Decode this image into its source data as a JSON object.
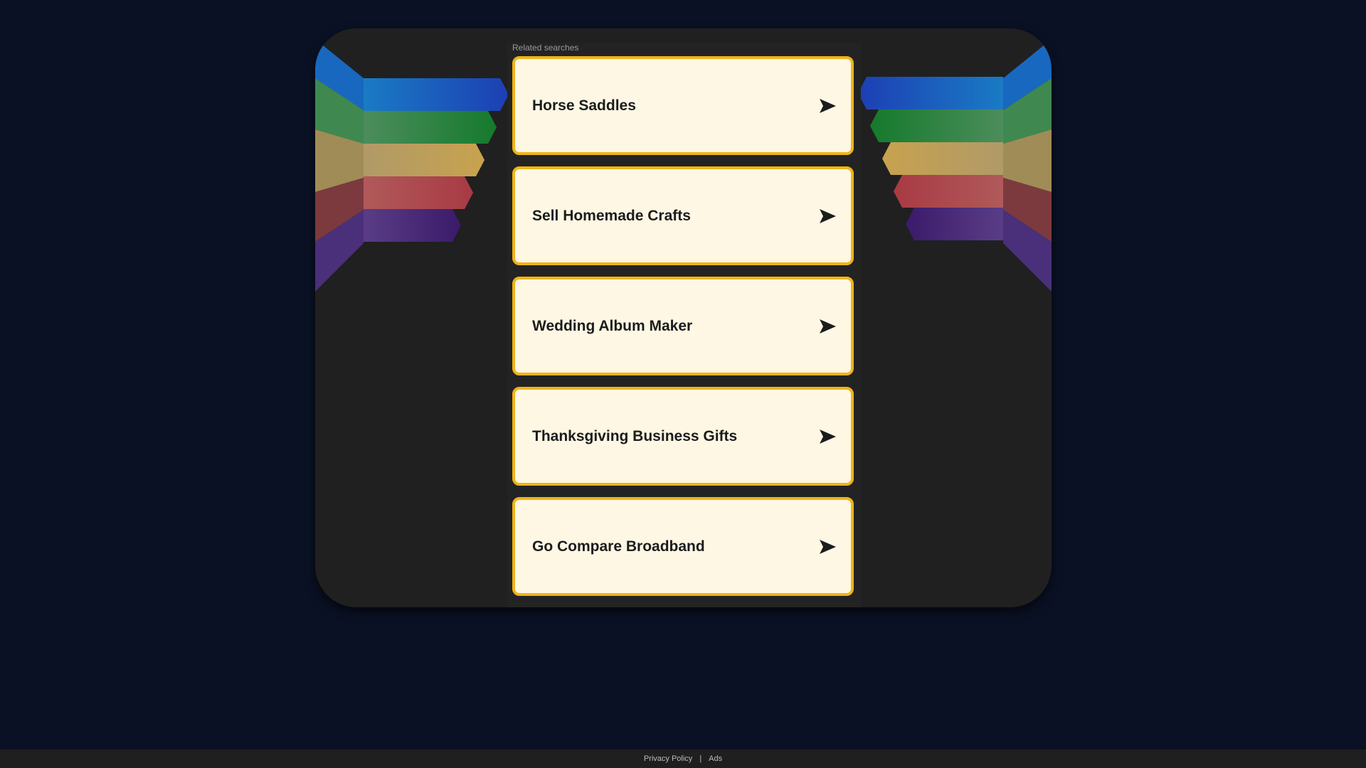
{
  "related_label": "Related searches",
  "searches": [
    {
      "label": "Horse Saddles"
    },
    {
      "label": "Sell Homemade Crafts"
    },
    {
      "label": "Wedding Album Maker"
    },
    {
      "label": "Thanksgiving Business Gifts"
    },
    {
      "label": "Go Compare Broadband"
    }
  ],
  "footer": {
    "privacy": "Privacy Policy",
    "separator": "|",
    "ads": "Ads"
  },
  "colors": {
    "background": "#0a1124",
    "panel": "#202020",
    "card_fill": "#fdf7e4",
    "card_border": "#f0b418",
    "stripes": [
      "#1a6fc0",
      "#1d8a3c",
      "#c8a24e",
      "#b3494f",
      "#5b2a8a"
    ]
  },
  "icons": {
    "card_arrow": "arrow-right-icon"
  }
}
